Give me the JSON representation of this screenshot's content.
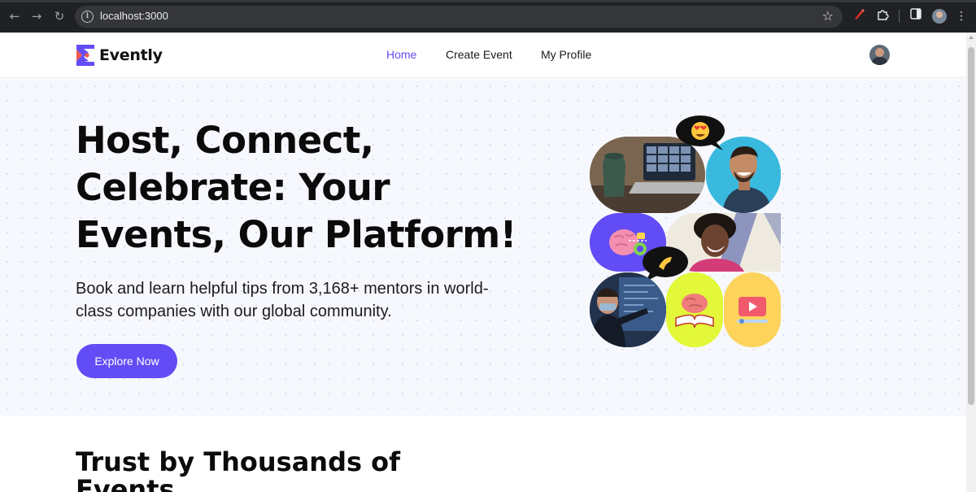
{
  "browser": {
    "url": "localhost:3000",
    "icons": [
      "back-arrow-icon",
      "forward-arrow-icon",
      "reload-icon",
      "site-info-icon",
      "bookmark-star-icon",
      "extension-red-icon",
      "extensions-puzzle-icon",
      "side-panel-icon",
      "profile-avatar-icon",
      "menu-dots-icon"
    ]
  },
  "header": {
    "brand": "Evently",
    "nav": [
      "Home",
      "Create Event",
      "My Profile"
    ],
    "active_nav": "Home"
  },
  "hero": {
    "title": "Host, Connect, Celebrate: Your Events, Our Platform!",
    "subtitle": "Book and learn helpful tips from 3,168+ mentors in world-class companies with our global community.",
    "cta": "Explore Now"
  },
  "trust": {
    "title": "Trust by Thousands of Events"
  },
  "colors": {
    "primary": "#624cf5",
    "hero_bg": "#f6f8fd",
    "tile_lime": "#e3f838",
    "tile_yellow": "#fdd35c",
    "tile_purple": "#624cf5"
  }
}
